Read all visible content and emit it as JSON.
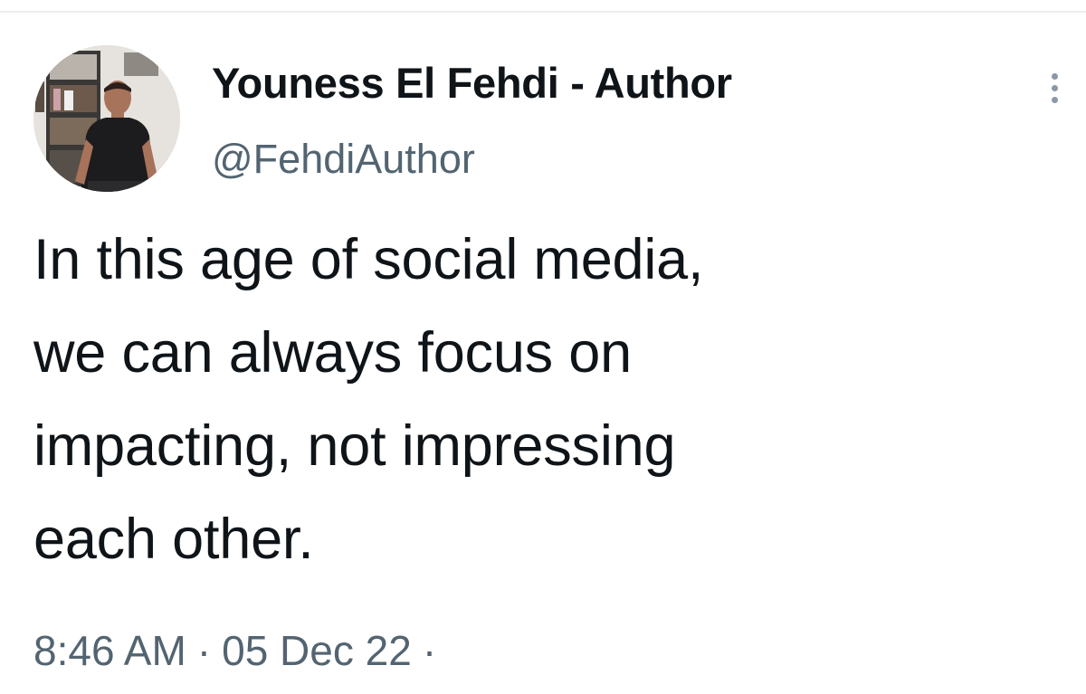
{
  "tweet": {
    "author": {
      "display_name": "Youness El Fehdi - Author",
      "handle": "@FehdiAuthor",
      "avatar": "author-photo"
    },
    "more_icon": "more-vertical-icon",
    "text_lines": [
      "In this age of social media,",
      "we can always focus on",
      "impacting, not impressing",
      "each other."
    ],
    "time": "8:46 AM",
    "date": "05 Dec 22",
    "separator": "·"
  },
  "colors": {
    "text_primary": "#0f1419",
    "text_secondary": "#536471",
    "background": "#ffffff"
  }
}
